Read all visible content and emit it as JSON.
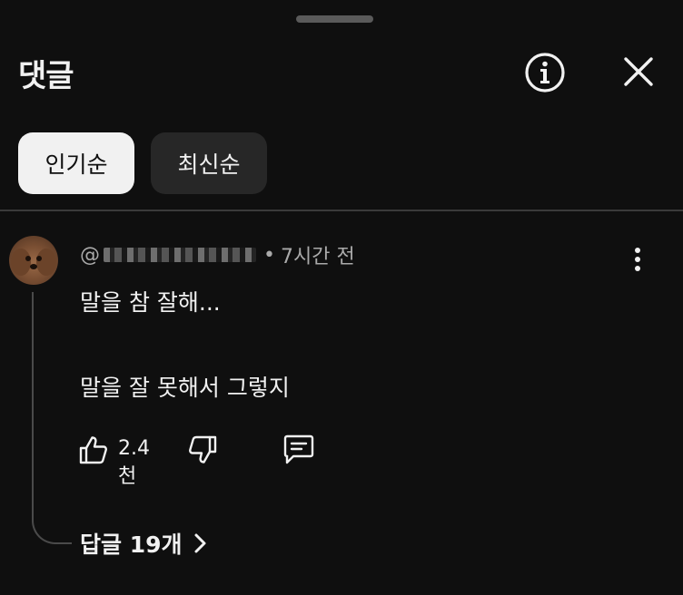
{
  "header": {
    "title": "댓글"
  },
  "sort_chips": [
    {
      "label": "인기순",
      "selected": true
    },
    {
      "label": "최신순",
      "selected": false
    }
  ],
  "comment": {
    "handle_prefix": "@",
    "time_separator": "•",
    "time": "7시간 전",
    "lines": [
      "말을 참 잘해...",
      "말을 잘 못해서 그렇지"
    ],
    "like_count": "2.4천",
    "replies_label": "답글 19개"
  },
  "colors": {
    "background": "#0f0f0f",
    "text_primary": "#f1f1f1",
    "text_secondary": "#aaaaaa",
    "chip_selected_bg": "#f1f1f1",
    "chip_unselected_bg": "#272727"
  },
  "icons": {
    "info": "info-icon",
    "close": "close-icon",
    "more": "more-vert-icon",
    "like": "thumb-up-icon",
    "dislike": "thumb-down-icon",
    "reply": "comment-icon",
    "chevron": "chevron-right-icon"
  }
}
